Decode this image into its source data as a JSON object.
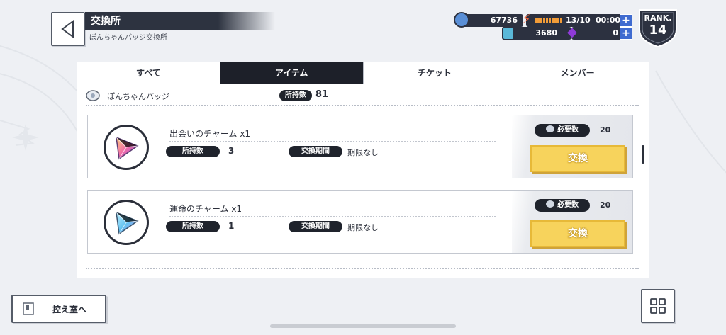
{
  "header": {
    "title": "交換所",
    "subtitle": "ぽんちゃんバッジ交換所"
  },
  "resources": {
    "coins": "67736",
    "stamina": "13/10",
    "stamina_timer": "00:00",
    "gems": "3680",
    "premium": "0",
    "rank_label": "RANK.",
    "rank_value": "14"
  },
  "tabs": [
    {
      "label": "すべて",
      "active": false
    },
    {
      "label": "アイテム",
      "active": true
    },
    {
      "label": "チケット",
      "active": false
    },
    {
      "label": "メンバー",
      "active": false
    }
  ],
  "currency": {
    "name": "ぽんちゃんバッジ",
    "owned_label": "所持数",
    "owned_value": "81"
  },
  "items": [
    {
      "name": "出会いのチャーム x1",
      "owned_label": "所持数",
      "owned_value": "3",
      "period_label": "交換期間",
      "period_value": "期限なし",
      "required_label": "必要数",
      "required_value": "20",
      "button_label": "交換",
      "icon": "pink-charm-icon"
    },
    {
      "name": "運命のチャーム x1",
      "owned_label": "所持数",
      "owned_value": "1",
      "period_label": "交換期間",
      "period_value": "期限なし",
      "required_label": "必要数",
      "required_value": "20",
      "button_label": "交換",
      "icon": "blue-charm-icon"
    }
  ],
  "footer": {
    "waiting_room_label": "控え室へ"
  },
  "colors": {
    "accent_dark": "#1d2029",
    "button_yellow": "#f7d35c",
    "plus_blue": "#3f6bd0",
    "rank_badge": "#2c3140"
  }
}
